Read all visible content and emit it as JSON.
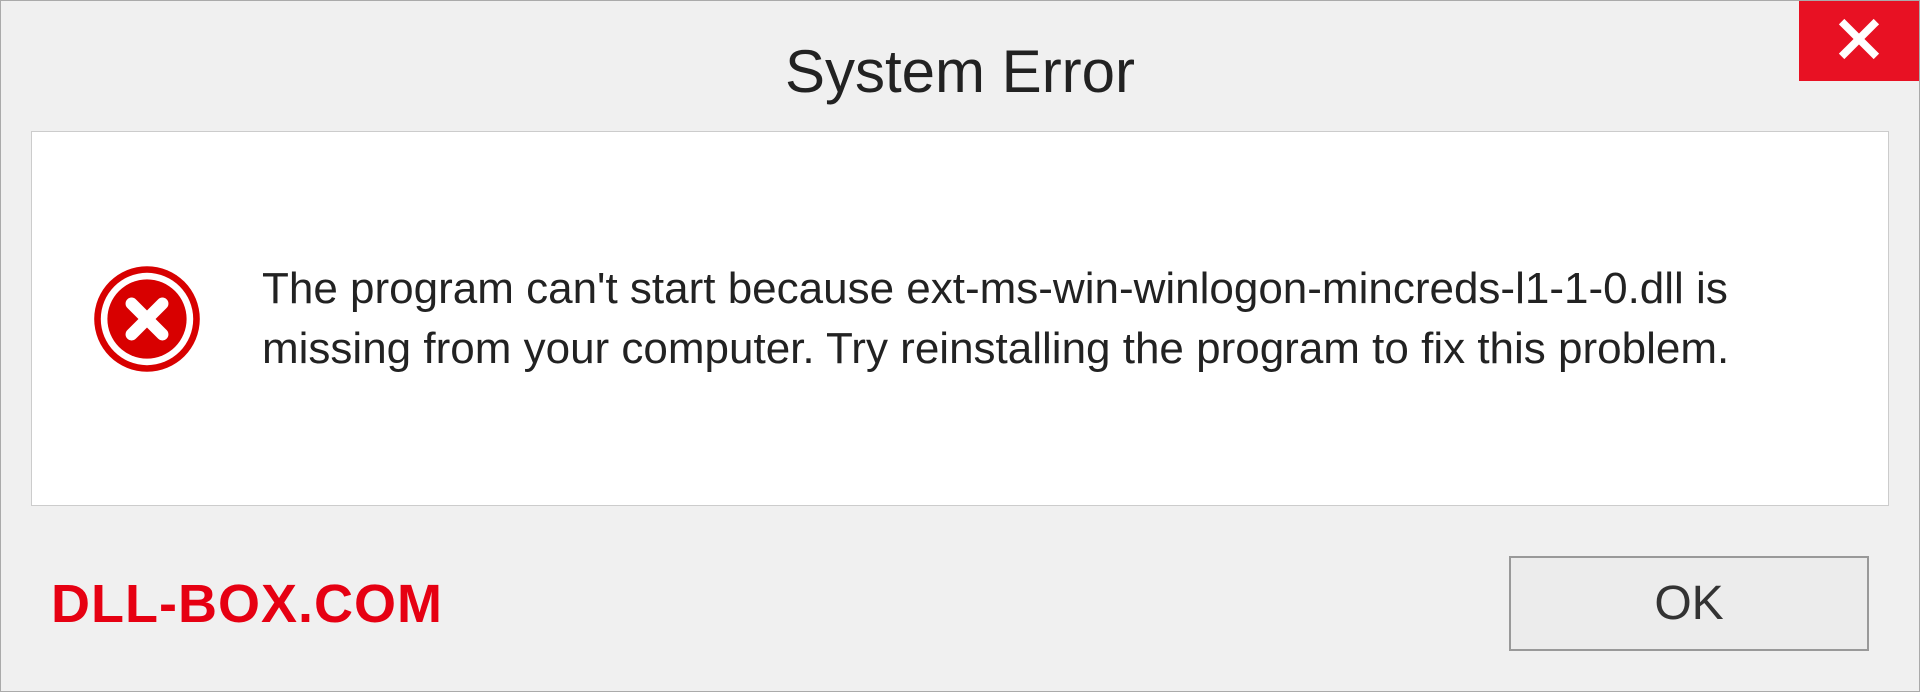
{
  "title": "System Error",
  "message": "The program can't start because ext-ms-win-winlogon-mincreds-l1-1-0.dll is missing from your computer. Try reinstalling the program to fix this problem.",
  "watermark": "DLL-BOX.COM",
  "ok_label": "OK"
}
